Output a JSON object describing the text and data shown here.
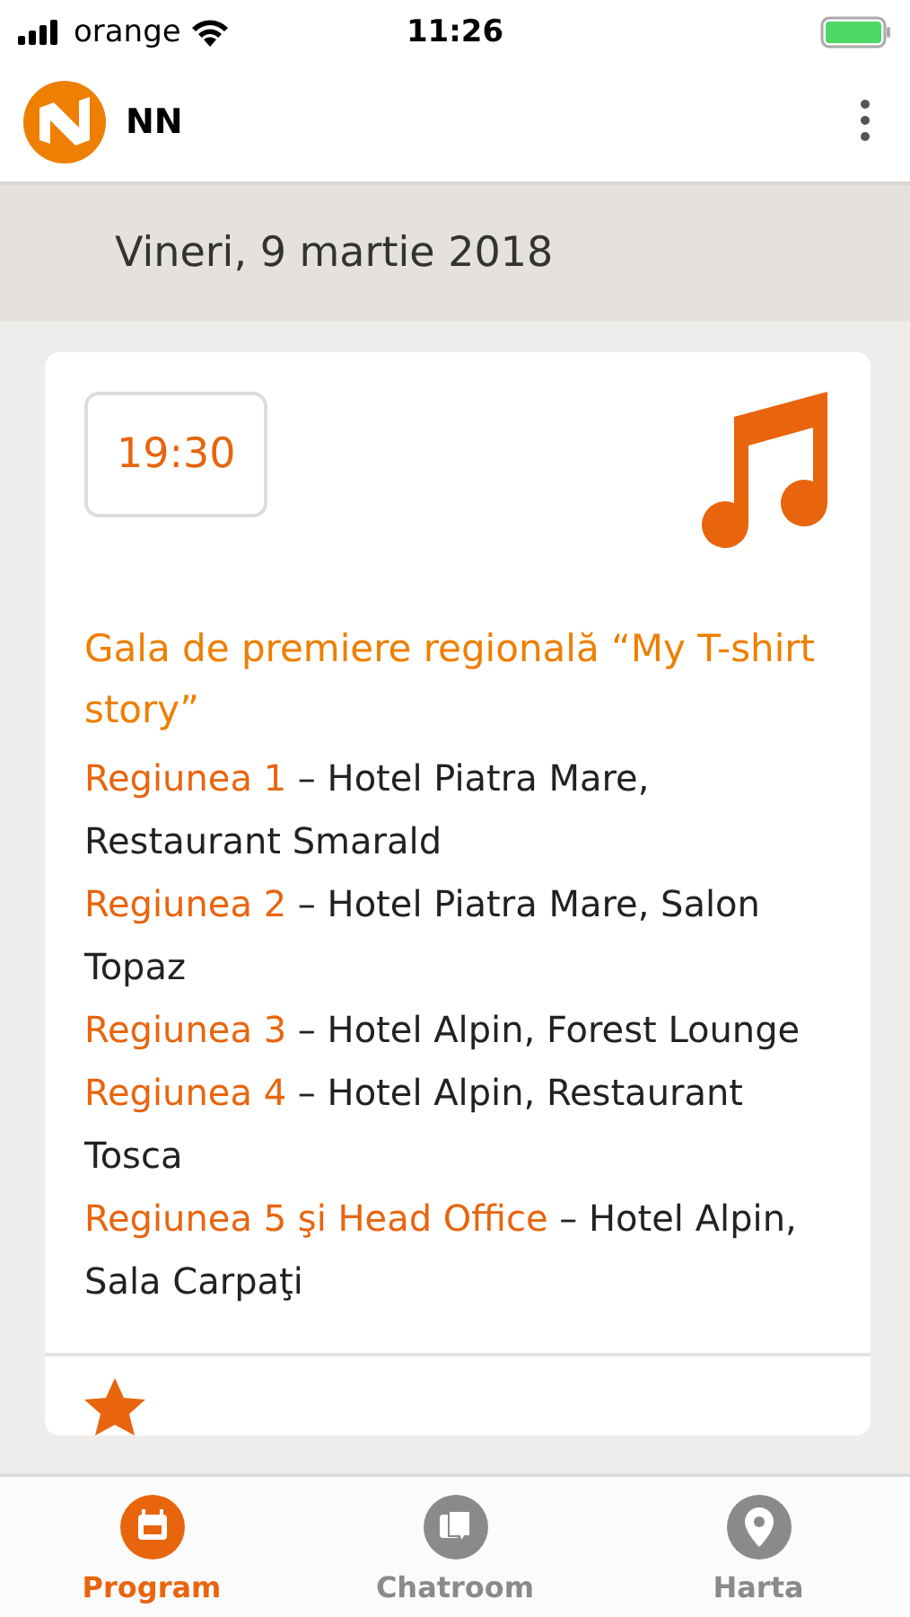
{
  "status_bar": {
    "carrier": "orange",
    "time": "11:26"
  },
  "header": {
    "title": "NN"
  },
  "date": "Vineri, 9 martie 2018",
  "event": {
    "time": "19:30",
    "title": "Gala de premiere regională “My T-shirt story”",
    "locations": [
      {
        "region": "Regiunea 1",
        "place": "– Hotel Piatra Mare, Restaurant Smarald"
      },
      {
        "region": "Regiunea 2",
        "place": "– Hotel Piatra Mare, Salon Topaz"
      },
      {
        "region": "Regiunea 3",
        "place": "– Hotel Alpin, Forest Lounge"
      },
      {
        "region": "Regiunea 4",
        "place": "– Hotel Alpin, Restaurant Tosca"
      },
      {
        "region": "Regiunea 5 şi Head Office",
        "place": "– Hotel Alpin, Sala Carpaţi"
      }
    ]
  },
  "tabs": [
    {
      "label": "Program",
      "kind": "calendar",
      "selected": true
    },
    {
      "label": "Chatroom",
      "kind": "chat",
      "selected": false
    },
    {
      "label": "Harta",
      "kind": "pin",
      "selected": false
    }
  ]
}
